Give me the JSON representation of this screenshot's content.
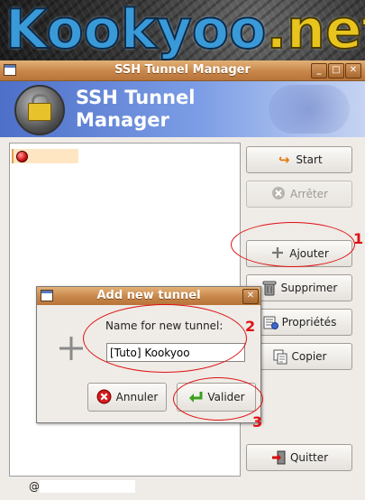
{
  "banner": {
    "text_main": "Kookyoo",
    "text_net": ".net"
  },
  "window": {
    "title": "SSH Tunnel Manager",
    "btn_minimize": "_",
    "btn_maximize": "□",
    "btn_close": "✕"
  },
  "header": {
    "title": "SSH Tunnel Manager"
  },
  "buttons": {
    "start": "Start",
    "arreter": "Arrêter",
    "ajouter": "Ajouter",
    "supprimer": "Supprimer",
    "proprietes": "Propriétés",
    "copier": "Copier",
    "quitter": "Quitter"
  },
  "statusbar": {
    "at": "@"
  },
  "dialog": {
    "title": "Add new tunnel",
    "label": "Name for new tunnel:",
    "input_value": "[Tuto] Kookyoo",
    "annuler": "Annuler",
    "valider": "Valider",
    "close": "✕"
  },
  "annotations": {
    "one": "1",
    "two": "2",
    "three": "3"
  },
  "colors": {
    "titlebar": "#c8864a",
    "header": "#4d6fc8",
    "annotation": "#dd1111"
  }
}
